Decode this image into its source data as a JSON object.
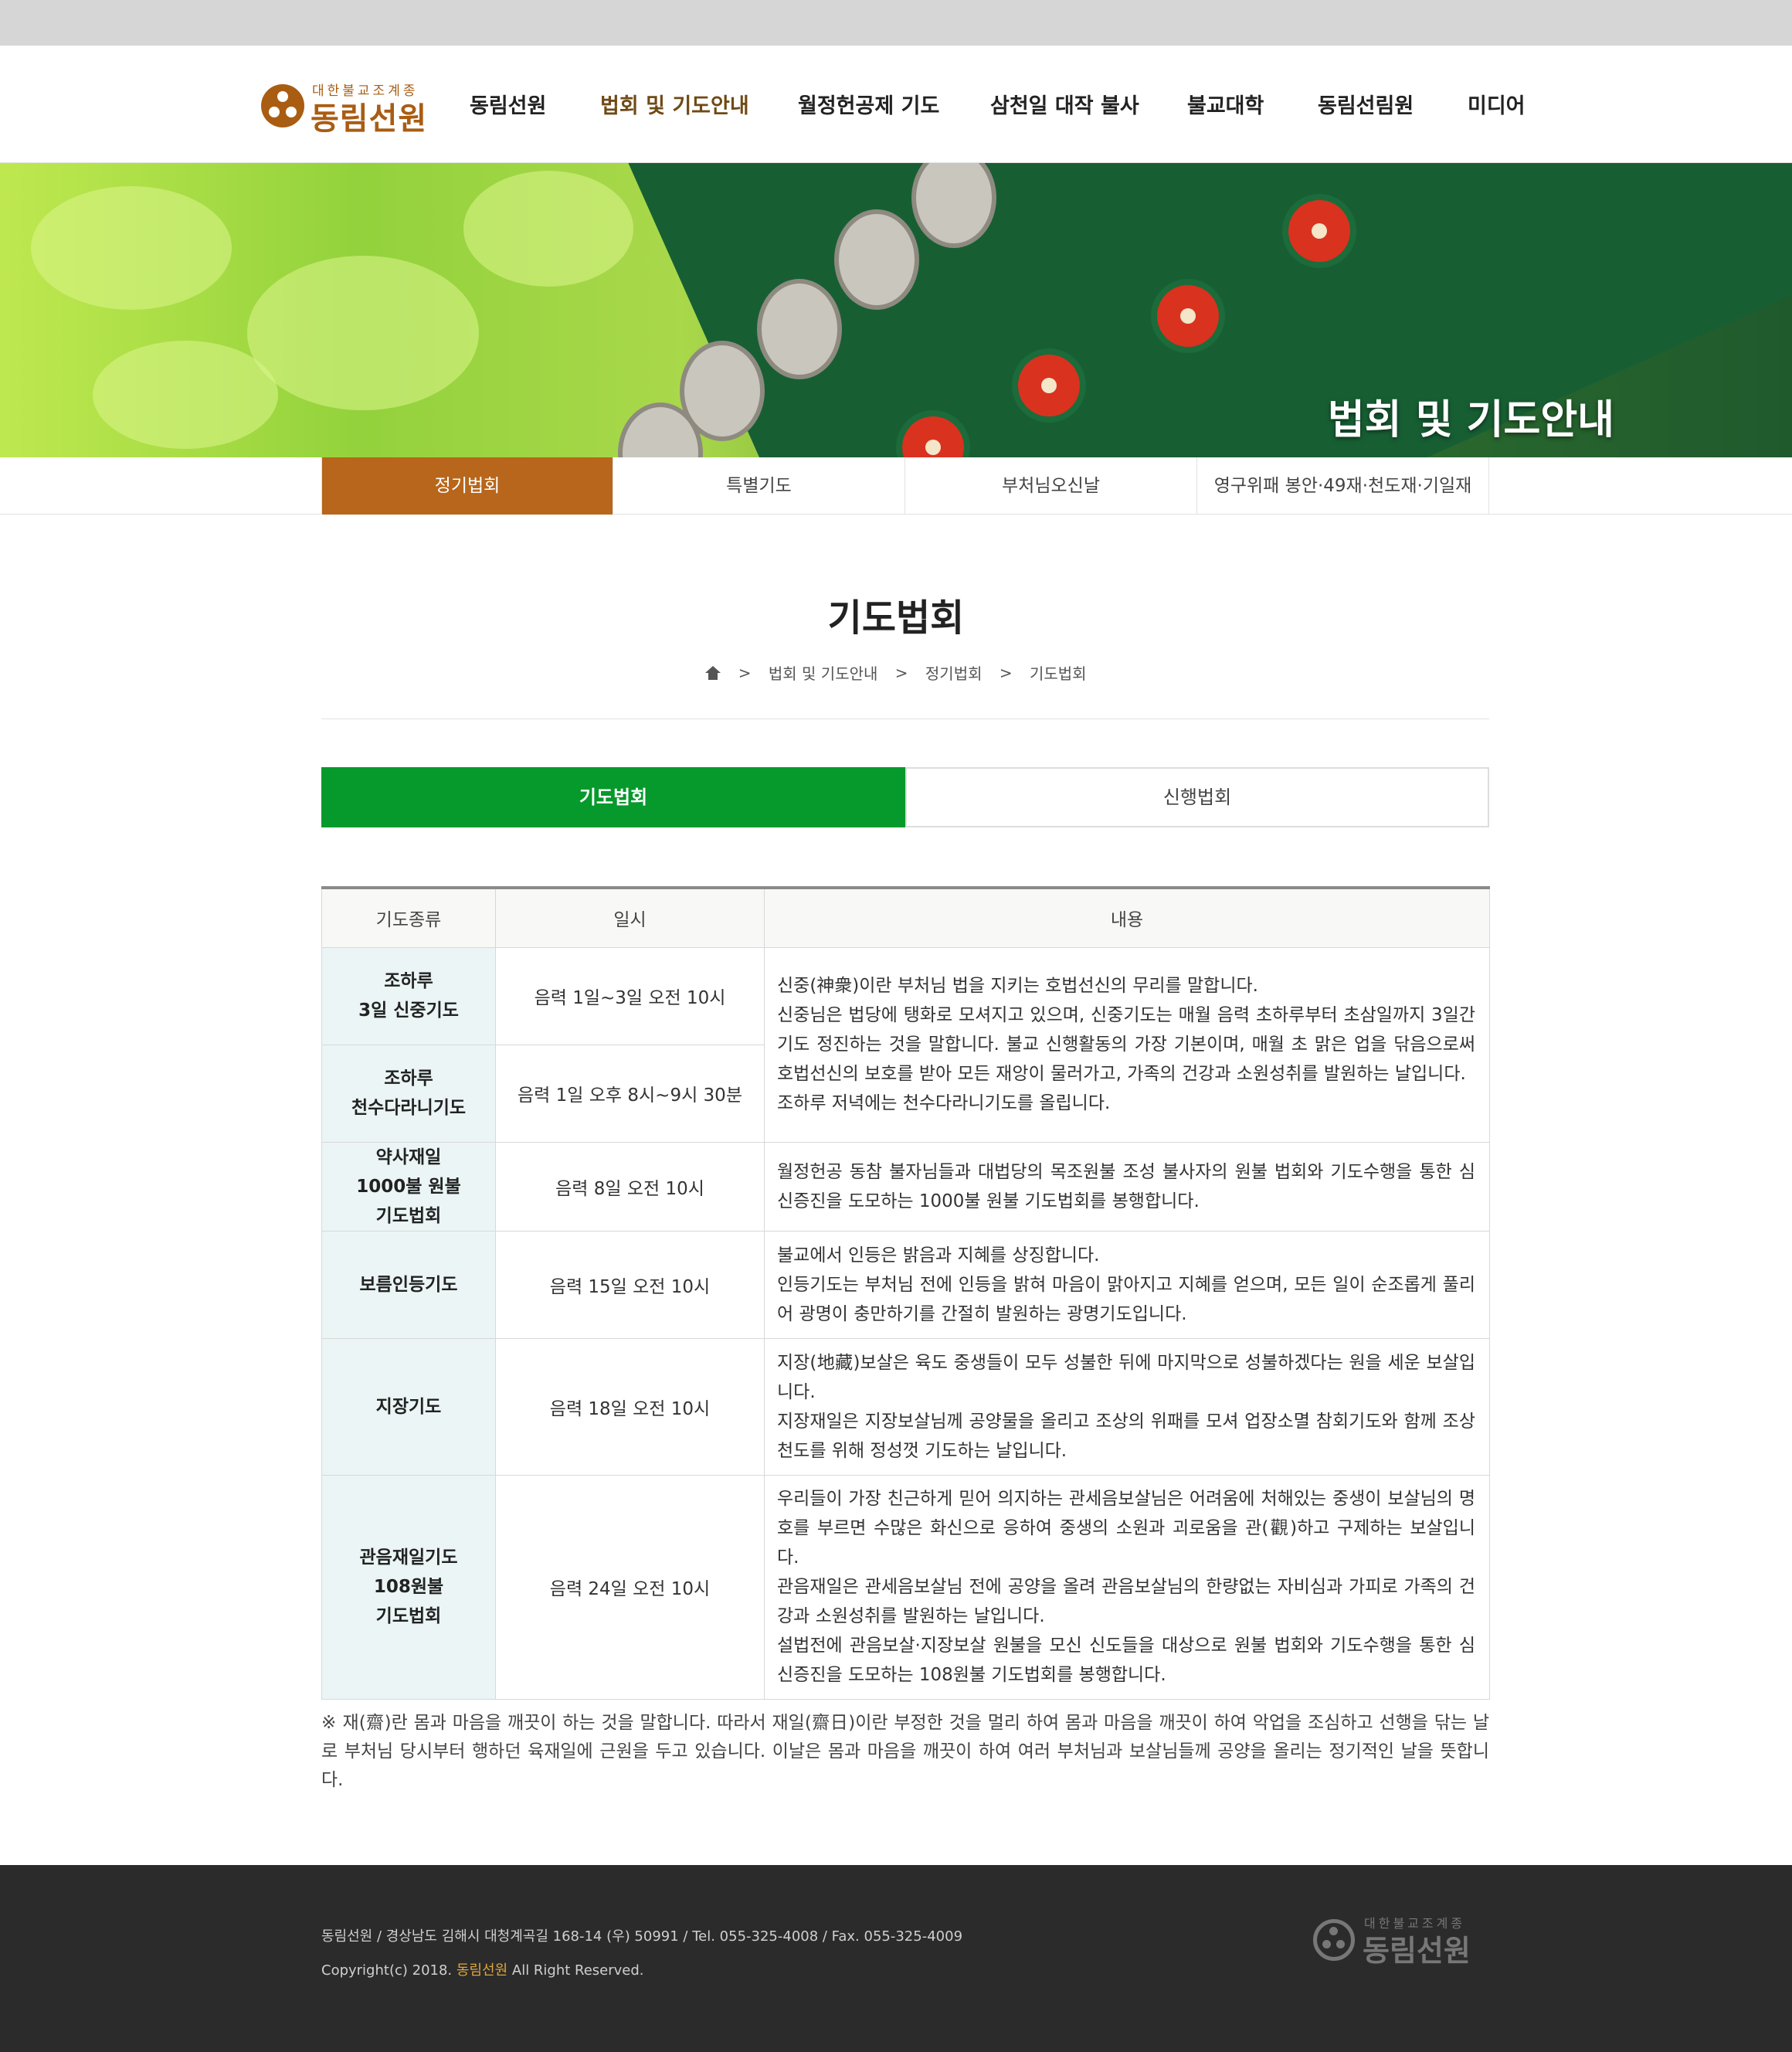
{
  "header": {
    "logo": {
      "small": "대한불교조계종",
      "big": "동림선원"
    },
    "nav": [
      "동림선원",
      "법회 및 기도안내",
      "월정헌공제 기도",
      "삼천일 대작 불사",
      "불교대학",
      "동림선림원",
      "미디어"
    ],
    "active_nav_color": "#6f4a16"
  },
  "hero": {
    "title": "법회 및 기도안내"
  },
  "subnav": {
    "tabs": [
      "정기법회",
      "특별기도",
      "부처님오신날",
      "영구위패 봉안·49재·천도재·기일재"
    ],
    "active_color": "#b8661b"
  },
  "page": {
    "title": "기도법회"
  },
  "breadcrumb": {
    "items": [
      "법회 및 기도안내",
      "정기법회",
      "기도법회"
    ]
  },
  "content_tabs": {
    "active": "기도법회",
    "inactive": "신행법회",
    "active_color": "#06992c"
  },
  "table": {
    "headers": [
      "기도종류",
      "일시",
      "내용"
    ],
    "rows": [
      {
        "type_lines": [
          "조하루",
          "3일 신중기도"
        ],
        "date": "음력 1일~3일 오전 10시"
      },
      {
        "type_lines": [
          "조하루",
          "천수다라니기도"
        ],
        "date": "음력 1일 오후 8시~9시 30분"
      },
      {
        "type_lines": [
          "약사재일",
          "1000불 원불",
          "기도법회"
        ],
        "date": "음력 8일 오전 10시"
      },
      {
        "type_lines": [
          "보름인등기도"
        ],
        "date": "음력 15일 오전 10시"
      },
      {
        "type_lines": [
          "지장기도"
        ],
        "date": "음력 18일 오전 10시"
      },
      {
        "type_lines": [
          "관음재일기도",
          "108원불",
          "기도법회"
        ],
        "date": "음력 24일 오전 10시"
      }
    ],
    "descriptions": [
      [
        "신중(神衆)이란 부처님 법을 지키는 호법선신의 무리를 말합니다.",
        "신중님은 법당에 탱화로 모셔지고 있으며, 신중기도는 매월 음력 초하루부터 초삼일까지 3일간 기도 정진하는 것을 말합니다. 불교 신행활동의 가장 기본이며, 매월 초 맑은 업을 닦음으로써 호법선신의 보호를 받아 모든 재앙이 물러가고, 가족의 건강과 소원성취를 발원하는 날입니다.",
        "조하루 저녁에는 천수다라니기도를 올립니다."
      ],
      [
        "월정헌공 동참 불자님들과 대법당의 목조원불 조성 불사자의 원불 법회와 기도수행을 통한 심신증진을 도모하는 1000불 원불 기도법회를 봉행합니다."
      ],
      [
        "불교에서 인등은 밝음과 지혜를 상징합니다.",
        "인등기도는 부처님 전에 인등을 밝혀 마음이 맑아지고 지혜를 얻으며, 모든 일이 순조롭게 풀리어 광명이 충만하기를 간절히 발원하는 광명기도입니다."
      ],
      [
        "지장(地藏)보살은 육도 중생들이 모두 성불한 뒤에 마지막으로 성불하겠다는 원을 세운 보살입니다.",
        "지장재일은 지장보살님께 공양물을 올리고 조상의 위패를 모셔 업장소멸 참회기도와 함께 조상천도를 위해 정성껏 기도하는 날입니다."
      ],
      [
        "우리들이 가장 친근하게 믿어 의지하는 관세음보살님은 어려움에 처해있는 중생이 보살님의 명호를 부르면 수많은 화신으로 응하여 중생의 소원과 괴로움을 관(觀)하고 구제하는 보살입니다.",
        "관음재일은 관세음보살님 전에 공양을 올려 관음보살님의 한량없는 자비심과 가피로 가족의 건강과 소원성취를 발원하는 날입니다.",
        "설법전에 관음보살·지장보살 원불을 모신 신도들을 대상으로 원불 법회와 기도수행을 통한 심신증진을 도모하는 108원불 기도법회를 봉행합니다."
      ]
    ]
  },
  "note": "※ 재(齋)란 몸과 마음을 깨끗이 하는 것을 말합니다. 따라서 재일(齋日)이란 부정한 것을 멀리 하여 몸과 마음을 깨끗이 하여 악업을 조심하고 선행을 닦는 날로 부처님 당시부터 행하던 육재일에 근원을 두고 있습니다. 이날은 몸과 마음을 깨끗이 하여 여러 부처님과 보살님들께 공양을 올리는 정기적인 날을 뜻합니다.",
  "footer": {
    "address": "동림선원 / 경상남도 김해시 대청계곡길 168-14 (우) 50991 / Tel. 055-325-4008 / Fax. 055-325-4009",
    "copyright_prefix": "Copyright(c) 2018.",
    "copyright_brand": "동림선원",
    "copyright_suffix": "All Right Reserved."
  }
}
